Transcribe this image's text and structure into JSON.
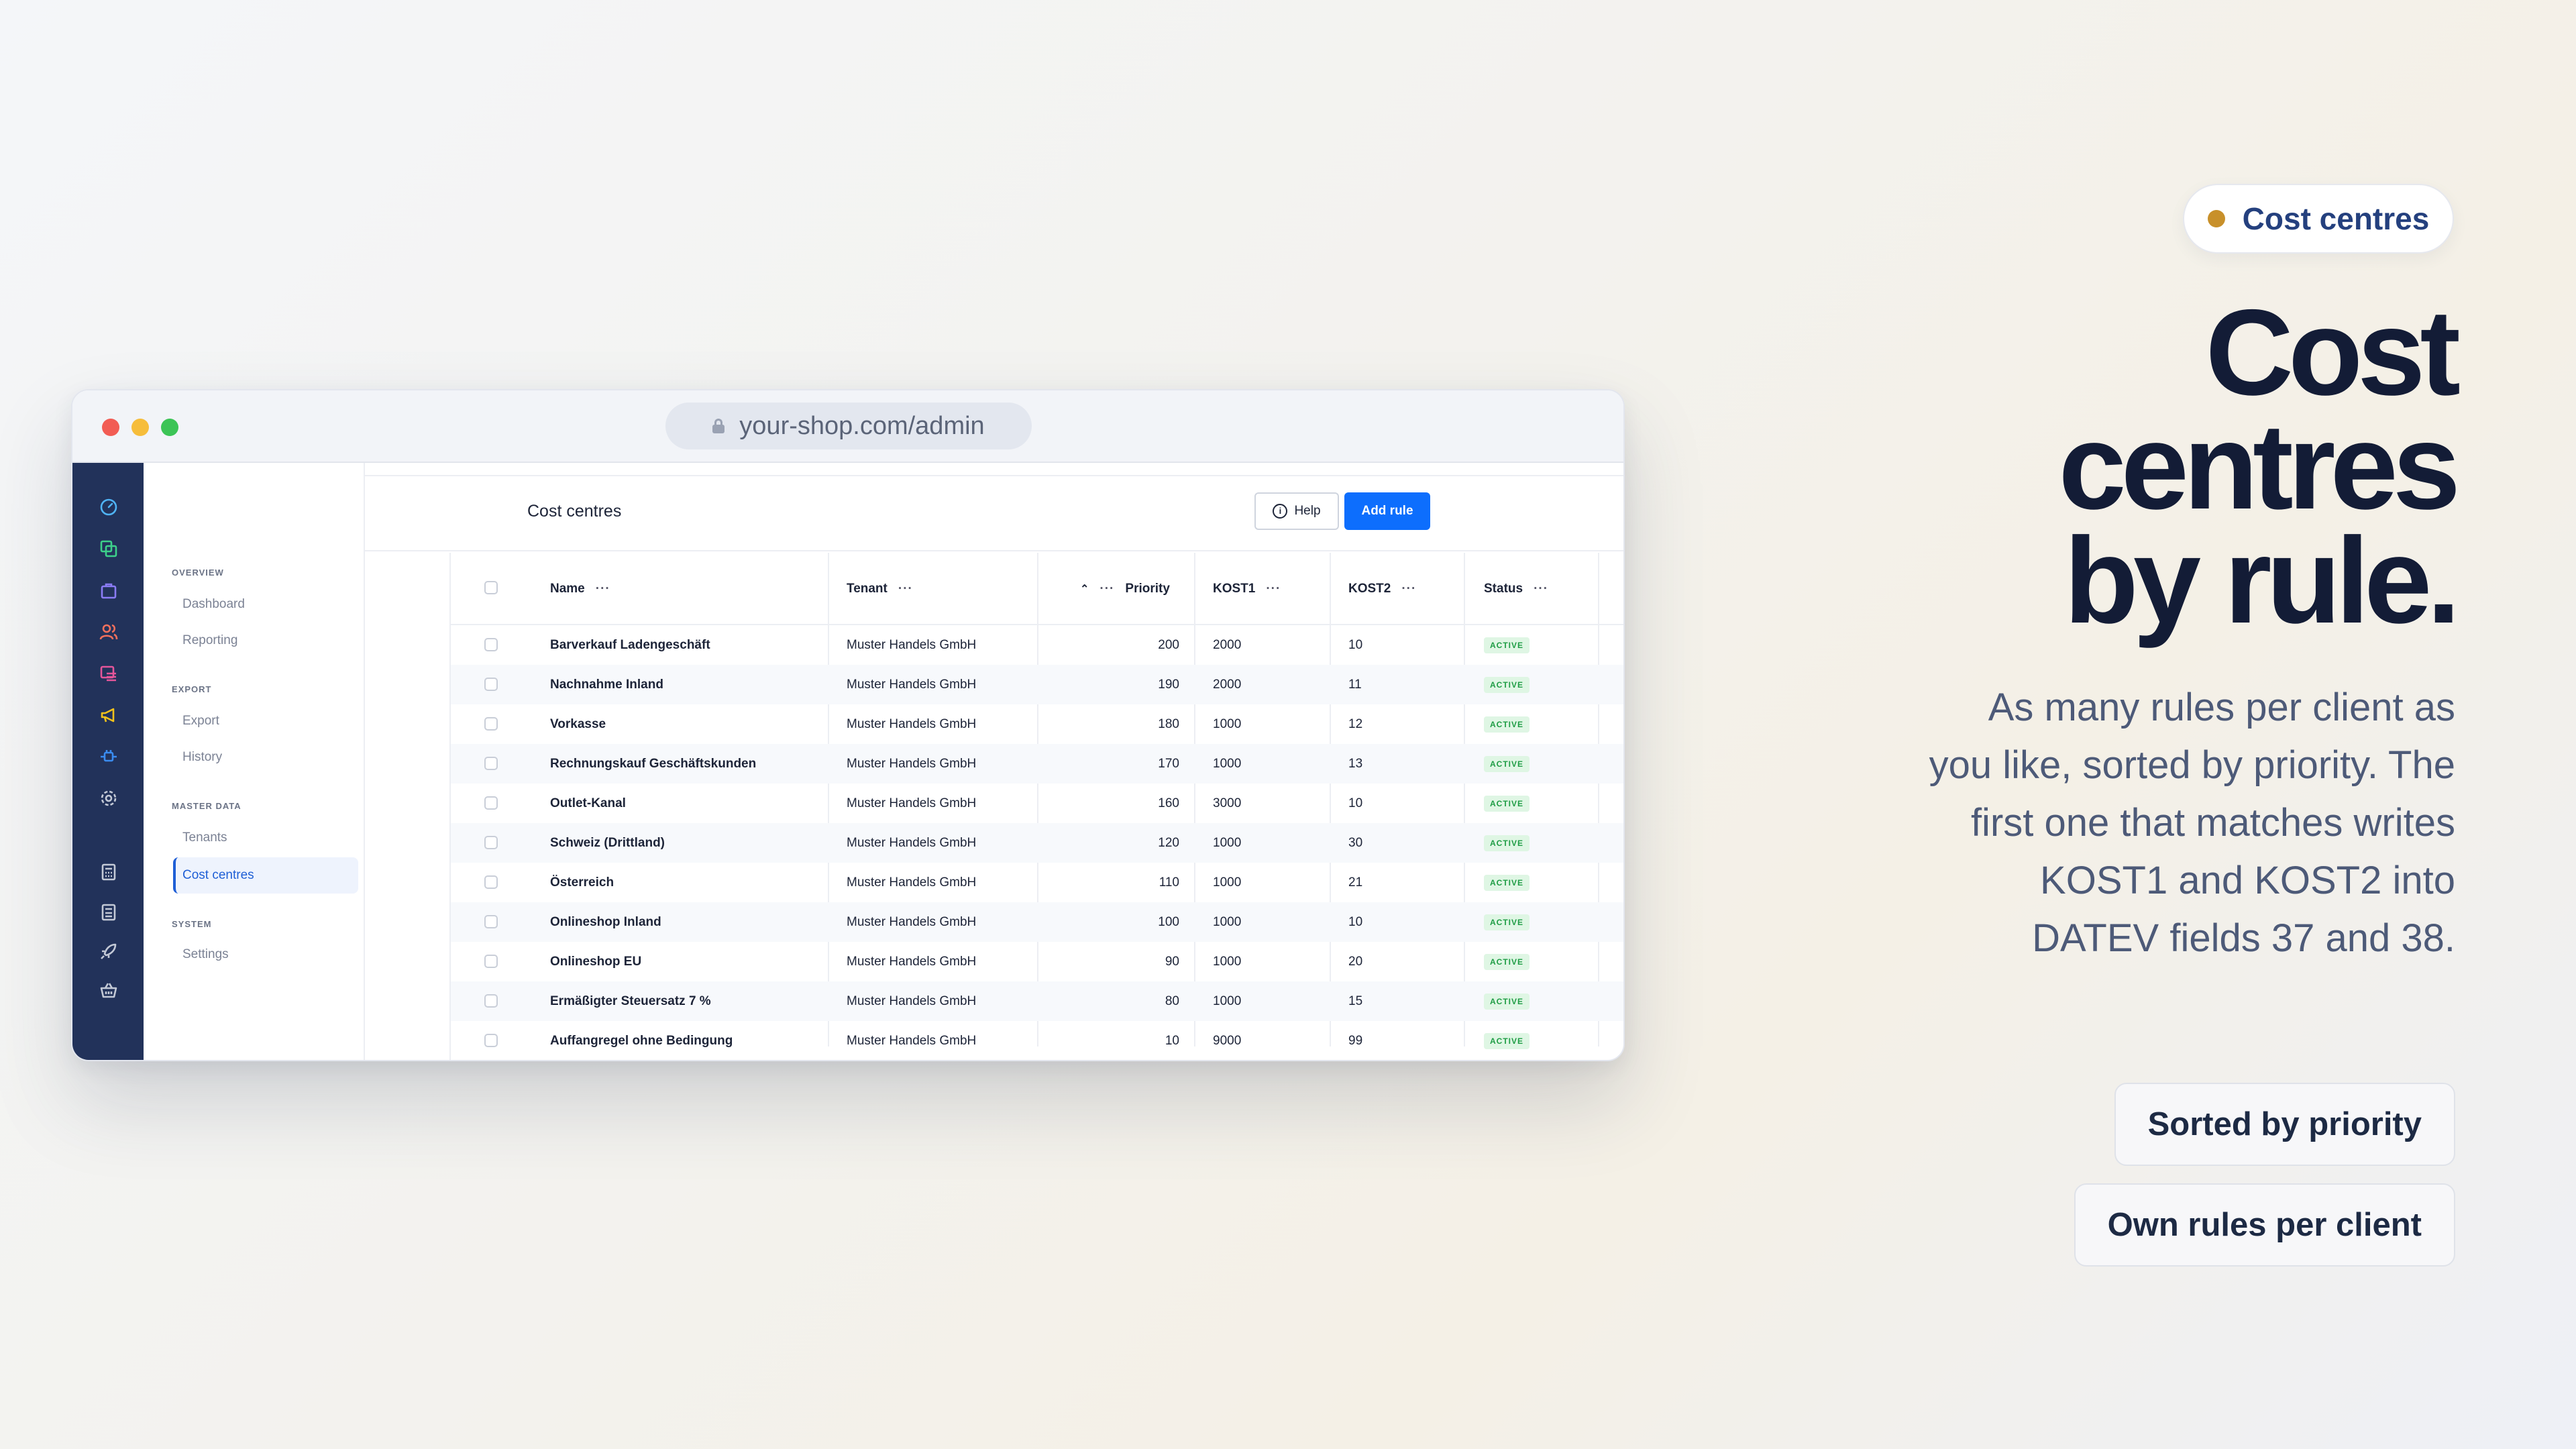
{
  "browser": {
    "url": "your-shop.com/admin"
  },
  "nav": {
    "sections": [
      {
        "title": "OVERVIEW",
        "items": [
          "Dashboard",
          "Reporting"
        ]
      },
      {
        "title": "EXPORT",
        "items": [
          "Export",
          "History"
        ]
      },
      {
        "title": "MASTER DATA",
        "items": [
          "Tenants",
          "Cost centres"
        ]
      },
      {
        "title": "SYSTEM",
        "items": [
          "Settings"
        ]
      }
    ],
    "active_item": "Cost centres"
  },
  "rail_icons": [
    "gauge-icon",
    "layers-icon",
    "bag-icon",
    "users-icon",
    "list-icon",
    "megaphone-icon",
    "plug-icon",
    "gear-icon",
    "calculator-icon",
    "calculator-icon",
    "rocket-icon",
    "basket-icon"
  ],
  "colors": {
    "rail_icons": [
      "#4fb3f5",
      "#3dd08a",
      "#8b7cf6",
      "#f2705c",
      "#e4569a",
      "#f2c21b",
      "#3a8cf0",
      "#c3c9d6",
      "#c3c9d6",
      "#c3c9d6",
      "#c3c9d6",
      "#c3c9d6"
    ],
    "primary_button": "#0d6efd",
    "status_active": "#1f9d45"
  },
  "header": {
    "title": "Cost centres",
    "help_label": "Help",
    "add_label": "Add rule"
  },
  "table": {
    "columns": {
      "name": "Name",
      "tenant": "Tenant",
      "priority": "Priority",
      "kost1": "KOST1",
      "kost2": "KOST2",
      "status": "Status"
    },
    "column_menu": "···",
    "row_menu": "···",
    "rows": [
      {
        "name": "Barverkauf Ladengeschäft",
        "tenant": "Muster Handels GmbH",
        "priority": "200",
        "kost1": "2000",
        "kost2": "10",
        "status": "ACTIVE"
      },
      {
        "name": "Nachnahme Inland",
        "tenant": "Muster Handels GmbH",
        "priority": "190",
        "kost1": "2000",
        "kost2": "11",
        "status": "ACTIVE"
      },
      {
        "name": "Vorkasse",
        "tenant": "Muster Handels GmbH",
        "priority": "180",
        "kost1": "1000",
        "kost2": "12",
        "status": "ACTIVE"
      },
      {
        "name": "Rechnungskauf Geschäftskunden",
        "tenant": "Muster Handels GmbH",
        "priority": "170",
        "kost1": "1000",
        "kost2": "13",
        "status": "ACTIVE"
      },
      {
        "name": "Outlet-Kanal",
        "tenant": "Muster Handels GmbH",
        "priority": "160",
        "kost1": "3000",
        "kost2": "10",
        "status": "ACTIVE"
      },
      {
        "name": "Schweiz (Drittland)",
        "tenant": "Muster Handels GmbH",
        "priority": "120",
        "kost1": "1000",
        "kost2": "30",
        "status": "ACTIVE"
      },
      {
        "name": "Österreich",
        "tenant": "Muster Handels GmbH",
        "priority": "110",
        "kost1": "1000",
        "kost2": "21",
        "status": "ACTIVE"
      },
      {
        "name": "Onlineshop Inland",
        "tenant": "Muster Handels GmbH",
        "priority": "100",
        "kost1": "1000",
        "kost2": "10",
        "status": "ACTIVE"
      },
      {
        "name": "Onlineshop EU",
        "tenant": "Muster Handels GmbH",
        "priority": "90",
        "kost1": "1000",
        "kost2": "20",
        "status": "ACTIVE"
      },
      {
        "name": "Ermäßigter Steuersatz 7 %",
        "tenant": "Muster Handels GmbH",
        "priority": "80",
        "kost1": "1000",
        "kost2": "15",
        "status": "ACTIVE"
      },
      {
        "name": "Auffangregel ohne Bedingung",
        "tenant": "Muster Handels GmbH",
        "priority": "10",
        "kost1": "9000",
        "kost2": "99",
        "status": "ACTIVE"
      }
    ]
  },
  "marketing": {
    "pill_label": "Cost centres",
    "pill_dot_color": "#c8902a",
    "headline_lines": [
      "Cost",
      "centres",
      "by rule."
    ],
    "subtext": "As many rules per client as you like, sorted by priority. The first one that matches writes KOST1 and KOST2 into DATEV fields 37 and 38.",
    "chips": [
      "Sorted by priority",
      "Own rules per client"
    ]
  }
}
